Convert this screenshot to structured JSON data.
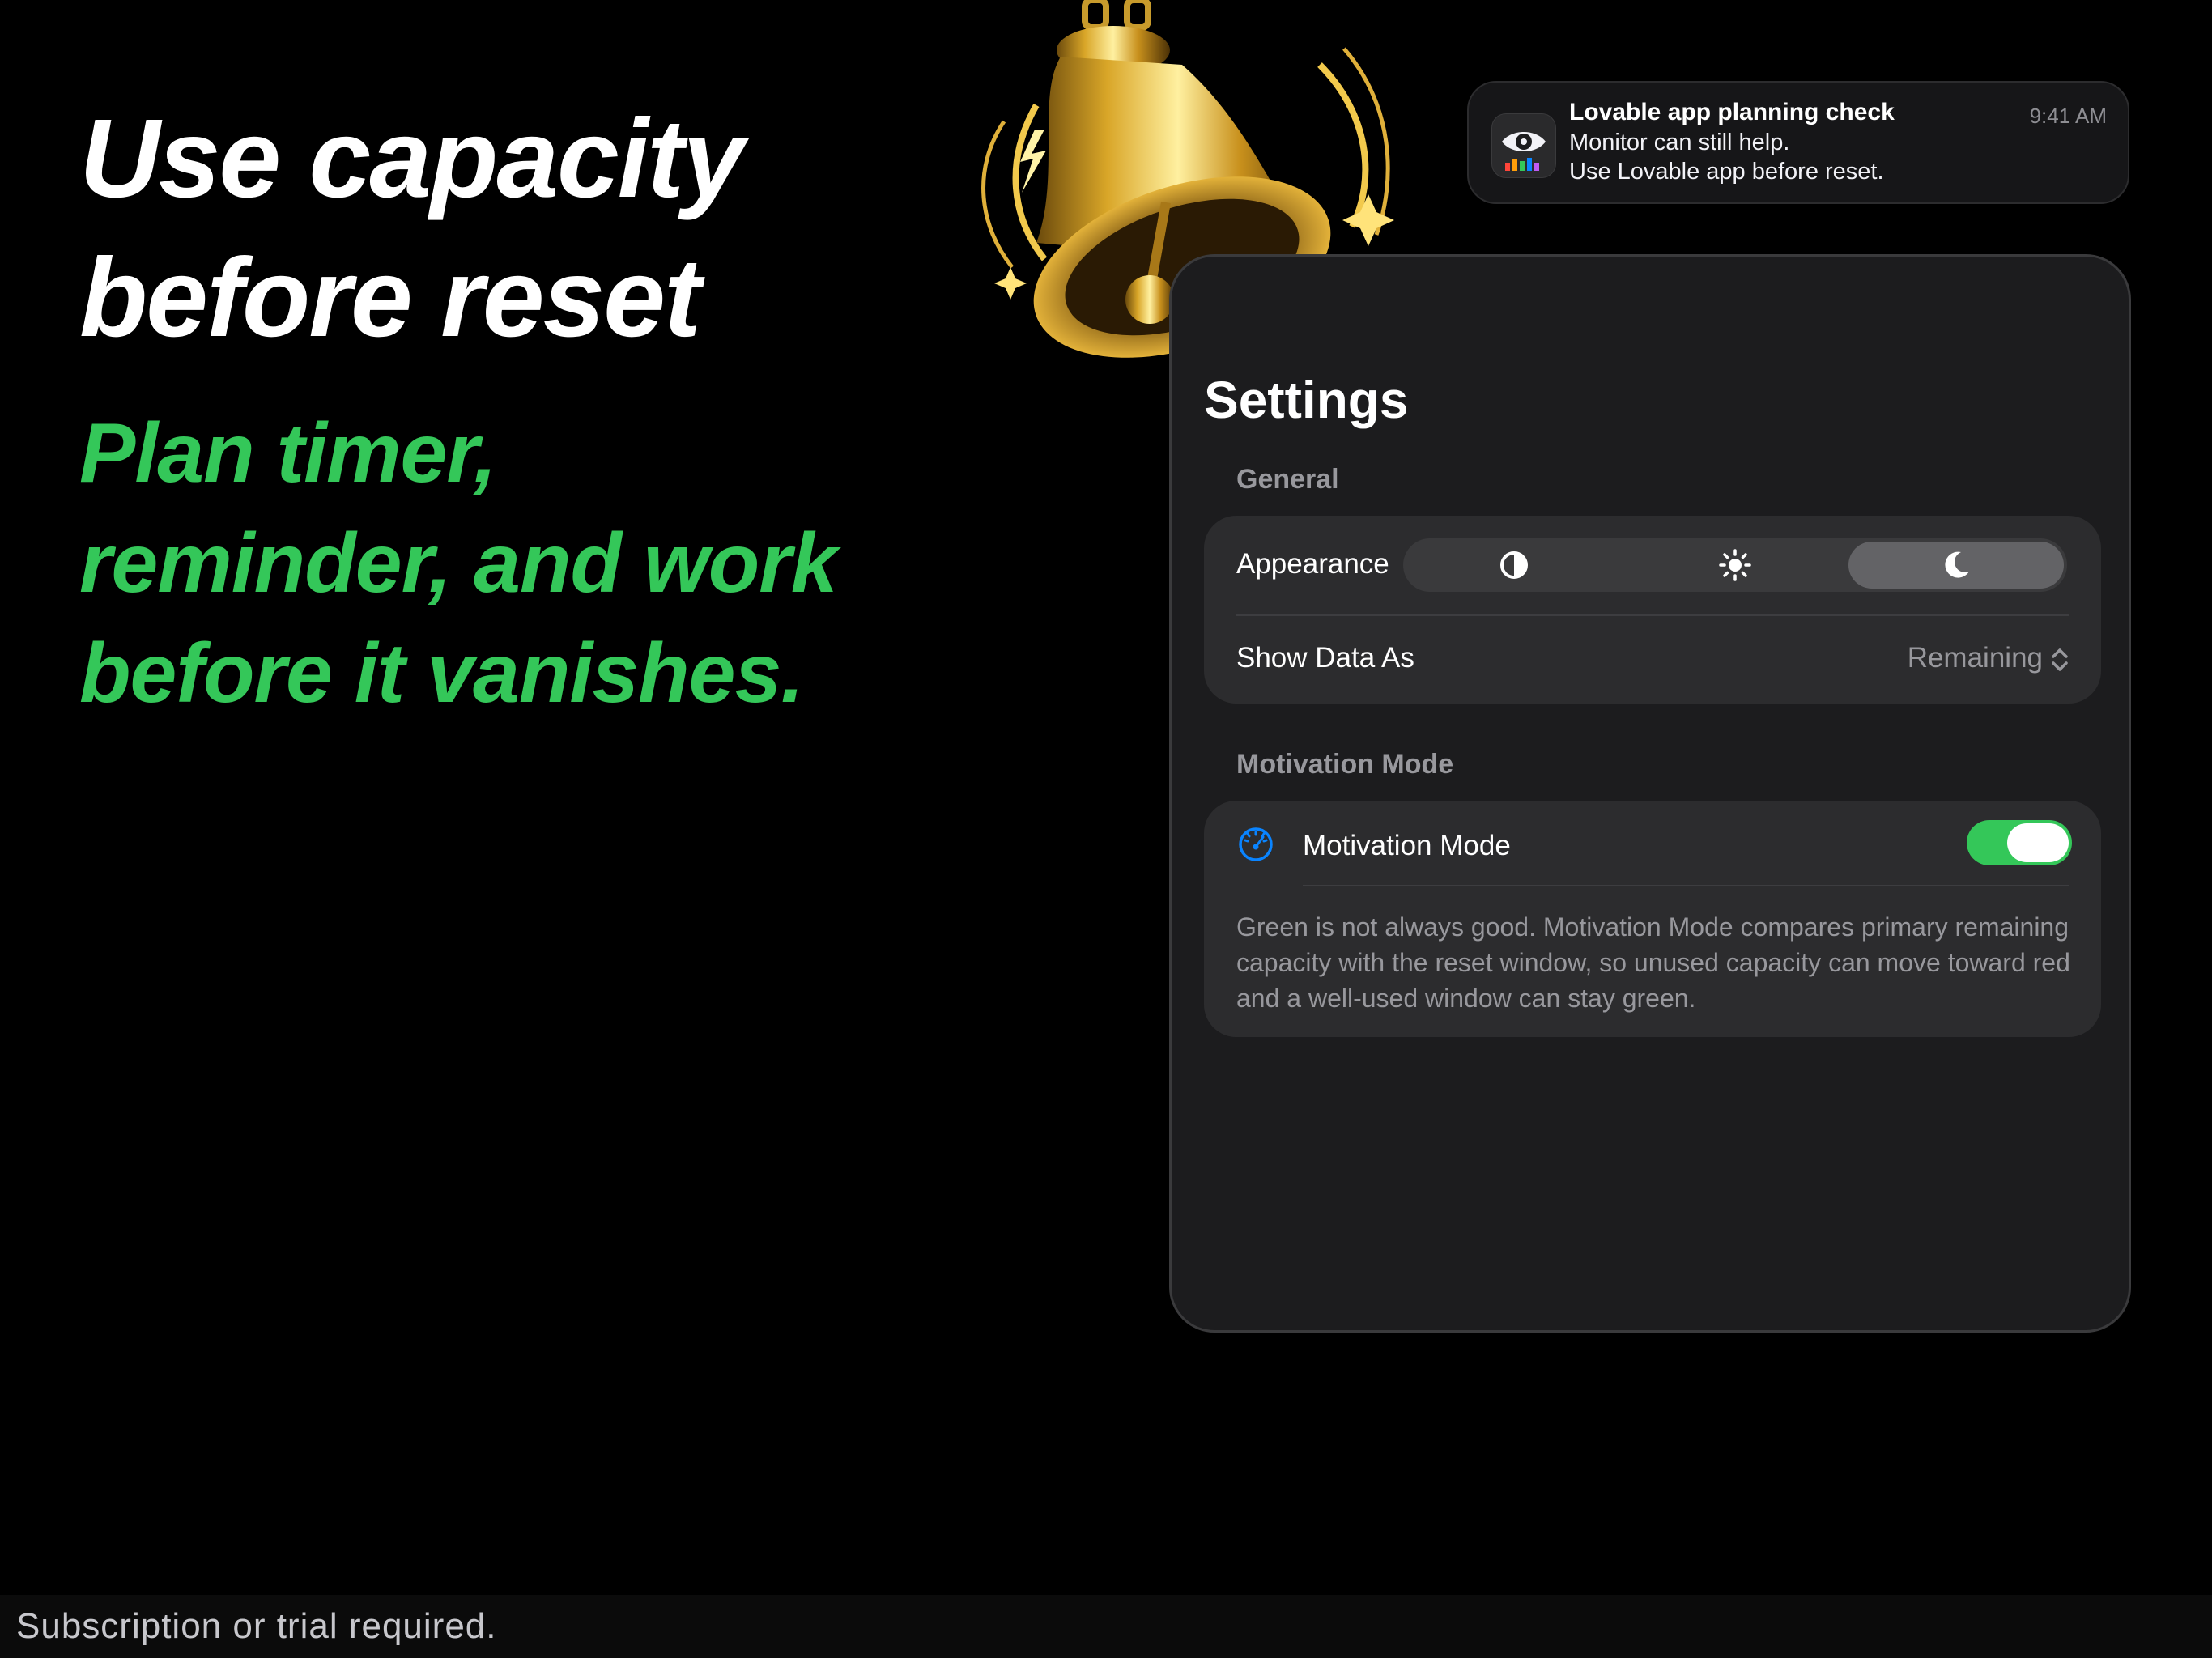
{
  "headline": {
    "line1": "Use capacity",
    "line2": "before reset"
  },
  "subline": {
    "line1": "Plan timer,",
    "line2": "reminder, and work",
    "line3": "before it vanishes."
  },
  "notification": {
    "title": "Lovable app planning check",
    "line1": "Monitor can still help.",
    "line2": "Use Lovable app before reset.",
    "time": "9:41 AM",
    "icon": "eye-icon"
  },
  "settings": {
    "title": "Settings",
    "general": {
      "header": "General",
      "appearance_label": "Appearance",
      "appearance_options": [
        "auto-contrast-icon",
        "sun-icon",
        "moon-icon"
      ],
      "appearance_selected": "moon-icon",
      "show_data_label": "Show Data As",
      "show_data_value": "Remaining"
    },
    "motivation": {
      "header": "Motivation Mode",
      "toggle_label": "Motivation Mode",
      "toggle_on": true,
      "description": "Green is not always good. Motivation Mode compares primary remaining capacity with the reset window, so unused capacity can move toward red and a well-used window can stay green."
    }
  },
  "colors": {
    "accent_green": "#34c759",
    "link_blue": "#0a84ff",
    "panel": "#1c1c1e",
    "group": "#2c2c2e"
  },
  "footer": {
    "text": "Subscription or trial required."
  }
}
